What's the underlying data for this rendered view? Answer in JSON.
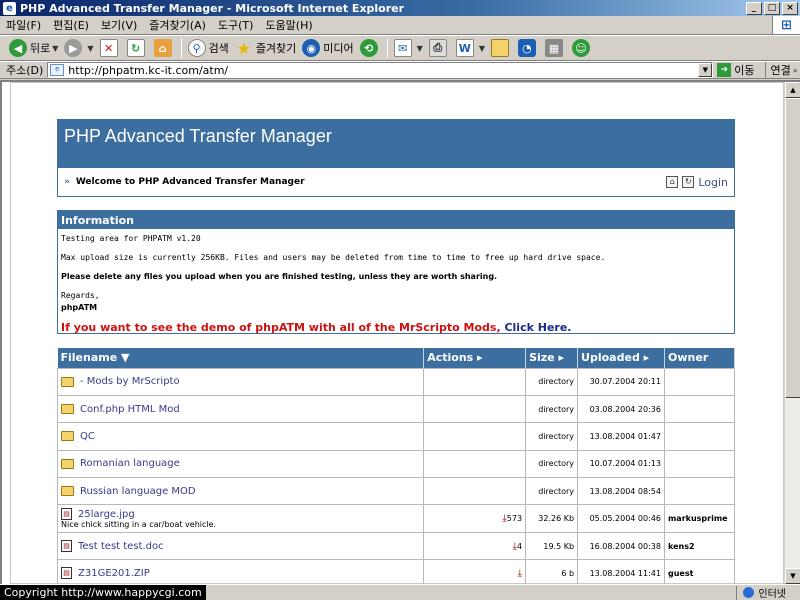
{
  "window": {
    "title": "PHP Advanced Transfer Manager - Microsoft Internet Explorer",
    "min": "_",
    "max": "□",
    "close": "×"
  },
  "menu": [
    "파일(F)",
    "편집(E)",
    "보기(V)",
    "즐겨찾기(A)",
    "도구(T)",
    "도움말(H)"
  ],
  "toolbar": {
    "back": "뒤로",
    "search": "검색",
    "favorites": "즐겨찾기",
    "media": "미디어"
  },
  "address": {
    "label": "주소(D)",
    "url": "http://phpatm.kc-it.com/atm/",
    "go": "이동",
    "links": "연결"
  },
  "header": {
    "app_title": "PHP Advanced Transfer Manager",
    "welcome": "Welcome to PHP Advanced Transfer Manager",
    "login": "Login"
  },
  "info": {
    "title": "Information",
    "line1": "Testing area for PHPATM v1.20",
    "line2": "Max upload size is currently 256KB. Files and users may be deleted from time to time to free up hard drive space.",
    "line3": "Please delete any files you upload when you are finished testing, unless they are worth sharing.",
    "regards": "Regards,",
    "signature": "phpATM",
    "mods_text": "If you want to see the demo of phpATM with all of the MrScripto Mods,",
    "mods_link": "Click Here."
  },
  "table": {
    "headers": {
      "filename": "Filename ▼",
      "actions": "Actions ▸",
      "size": "Size ▸",
      "uploaded": "Uploaded ▸",
      "owner": "Owner"
    },
    "rows": [
      {
        "type": "folder",
        "name": "- Mods by MrScripto",
        "desc": "",
        "actions": "",
        "size": "directory",
        "uploaded": "30.07.2004 20:11",
        "owner": ""
      },
      {
        "type": "folder",
        "name": "Conf.php HTML Mod",
        "desc": "",
        "actions": "",
        "size": "directory",
        "uploaded": "03.08.2004 20:36",
        "owner": ""
      },
      {
        "type": "folder",
        "name": "QC",
        "desc": "",
        "actions": "",
        "size": "directory",
        "uploaded": "13.08.2004 01:47",
        "owner": ""
      },
      {
        "type": "folder",
        "name": "Romanian language",
        "desc": "",
        "actions": "",
        "size": "directory",
        "uploaded": "10.07.2004 01:13",
        "owner": ""
      },
      {
        "type": "folder",
        "name": "Russian language MOD",
        "desc": "",
        "actions": "",
        "size": "directory",
        "uploaded": "13.08.2004 08:54",
        "owner": ""
      },
      {
        "type": "file",
        "name": "25large.jpg",
        "desc": "Nice chick sitting in a car/boat vehicle.",
        "actions": "573",
        "size": "32.26 Kb",
        "uploaded": "05.05.2004 00:46",
        "owner": "markusprime"
      },
      {
        "type": "file",
        "name": "Test test test.doc",
        "desc": "",
        "actions": "4",
        "size": "19.5 Kb",
        "uploaded": "16.08.2004 00:38",
        "owner": "kens2"
      },
      {
        "type": "file",
        "name": "Z31GE201.ZIP",
        "desc": "",
        "actions": "",
        "size": "6 b",
        "uploaded": "13.08.2004 11:41",
        "owner": "guest"
      }
    ]
  },
  "status": {
    "copyright": "Copyright   http://www.happycgi.com",
    "zone": "인터넷"
  },
  "colors": {
    "header_blue": "#3d6ea0",
    "mods_red": "#cc1111",
    "title_dark": "#0a246a"
  }
}
